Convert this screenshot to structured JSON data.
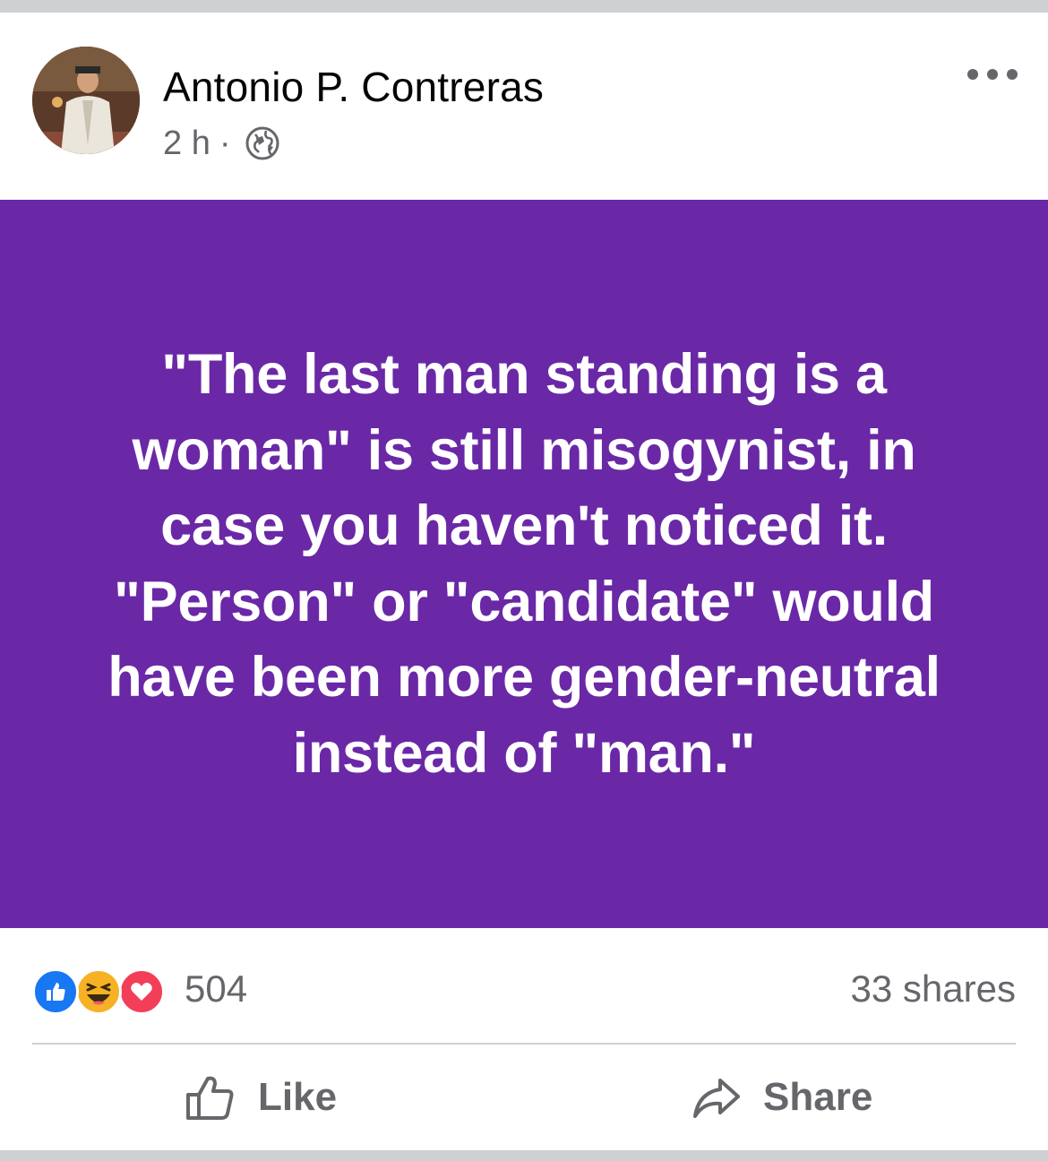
{
  "post": {
    "author": "Antonio P. Contreras",
    "time": "2 h",
    "separator": "·",
    "privacy_icon": "globe-icon",
    "more_icon": "more-options-icon",
    "background_color": "#6a28a6",
    "text": "\"The last man standing is a woman\" is still misogynist, in case you haven't noticed it. \"Person\" or \"candidate\" would have been more gender-neutral instead of \"man.\""
  },
  "engagement": {
    "reaction_icons": [
      "like-icon",
      "haha-icon",
      "love-icon"
    ],
    "reaction_count": "504",
    "shares": "33 shares"
  },
  "actions": {
    "like_label": "Like",
    "share_label": "Share"
  },
  "colors": {
    "like_blue": "#1877f2",
    "haha_yellow": "#f7b125",
    "love_red": "#f33e58",
    "secondary_text": "#65676b"
  }
}
